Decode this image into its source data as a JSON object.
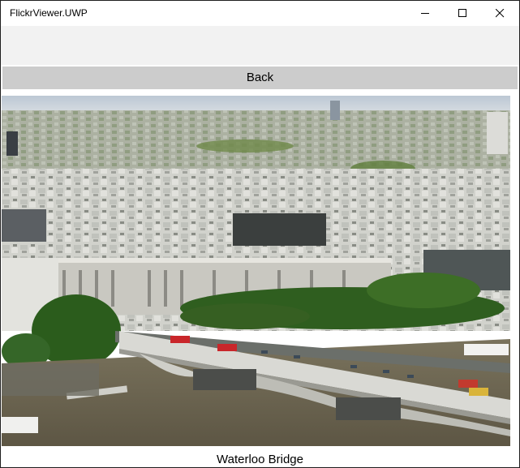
{
  "window": {
    "title": "FlickrViewer.UWP",
    "controls": {
      "minimize_icon": "minimize-icon",
      "maximize_icon": "maximize-icon",
      "close_icon": "close-icon"
    }
  },
  "toolbar": {
    "back_label": "Back"
  },
  "photo": {
    "caption": "Waterloo Bridge",
    "subject": "aerial view of London riverside with Waterloo Bridge"
  },
  "colors": {
    "title_bar": "#ffffff",
    "app_header": "#f2f2f2",
    "back_button": "#cccccc",
    "river": "#6d6450",
    "sky": "#c9d3df"
  }
}
